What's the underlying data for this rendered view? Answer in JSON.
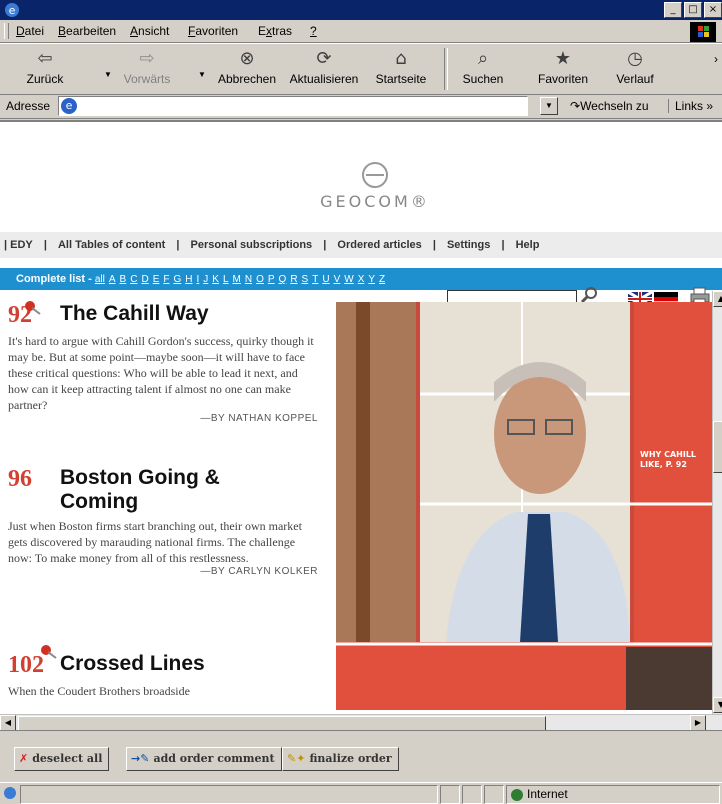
{
  "window": {
    "minimize": "_",
    "maximize": "□",
    "close": "×"
  },
  "menu": [
    {
      "accel": "D",
      "rest": "atei"
    },
    {
      "accel": "B",
      "rest": "earbeiten"
    },
    {
      "accel": "A",
      "rest": "nsicht"
    },
    {
      "accel": "F",
      "rest": "avoriten"
    },
    {
      "pre": "E",
      "accel": "x",
      "rest": "tras"
    },
    {
      "accel": "?",
      "rest": ""
    }
  ],
  "toolbar": {
    "back": "Zurück",
    "forward": "Vorwärts",
    "stop": "Abbrechen",
    "refresh": "Aktualisieren",
    "home": "Startseite",
    "search": "Suchen",
    "favorites": "Favoriten",
    "history": "Verlauf",
    "overflow": "›"
  },
  "address": {
    "label": "Adresse",
    "value": "",
    "go": "Wechseln zu",
    "links": "Links »"
  },
  "site": {
    "logo_text": "GEOCOM®",
    "nav": [
      "| EDY",
      "|",
      "All Tables of content",
      "|",
      "Personal subscriptions",
      "|",
      "Ordered articles",
      "|",
      "Settings",
      "|",
      "Help"
    ],
    "complete_list": "Complete list -",
    "letters": [
      "all",
      "A",
      "B",
      "C",
      "D",
      "E",
      "F",
      "G",
      "H",
      "I",
      "J",
      "K",
      "L",
      "M",
      "N",
      "O",
      "P",
      "Q",
      "R",
      "S",
      "T",
      "U",
      "V",
      "W",
      "X",
      "Y",
      "Z"
    ],
    "search_value": ""
  },
  "articles": [
    {
      "num": "92",
      "title": "The Cahill Way",
      "body": "It's hard to argue with Cahill Gordon's success, quirky though it may be. But at some point—maybe soon—it will have to face these critical questions: Who will be able to lead it next, and how can it keep attracting talent if almost no one can make partner?",
      "byline": "—BY NATHAN KOPPEL"
    },
    {
      "num": "96",
      "title": "Boston Going & Coming",
      "body": "Just when Boston firms start branching out, their own market gets discovered by marauding national firms. The challenge now: To make money from all of this restlessness.",
      "byline": "—BY CARLYN KOLKER"
    },
    {
      "num": "102",
      "title": "Crossed Lines",
      "body": "When the Coudert Brothers broadside",
      "byline": ""
    }
  ],
  "photo_caption": "WHY CAHILL LIKE, P. 92",
  "actions": {
    "deselect": "deselect all",
    "comment": "add order comment",
    "finalize": "finalize order"
  },
  "status": {
    "zone": "Internet"
  }
}
